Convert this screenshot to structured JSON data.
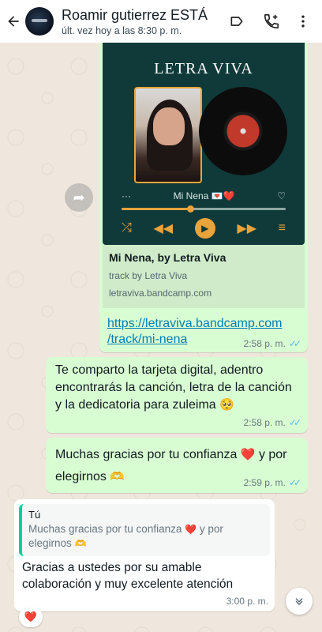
{
  "header": {
    "contact_name": "Roamir gutierrez ESTÁ",
    "status": "últ. vez hoy a las 8:30 p. m.",
    "icons": [
      "back-arrow-icon",
      "label-icon",
      "add-call-icon",
      "more-vert-icon"
    ]
  },
  "card": {
    "logo": "LETRA VIVA",
    "song": "Mi Nena",
    "song_emojis": "💌❤️",
    "progress": 0.42
  },
  "link_preview": {
    "title": "Mi Nena, by Letra Viva",
    "description": "track by Letra Viva",
    "domain": "letraviva.bandcamp.com"
  },
  "messages": [
    {
      "id": "m1",
      "url_line1": "https://letraviva.bandcamp.com",
      "url_line2": "/track/mi-nena",
      "time": "2:58 p. m."
    },
    {
      "id": "m2",
      "text": "Te comparto la tarjeta digital, adentro encontrarás la canción, letra de la canción y la dedicatoria para zuleima",
      "emoji": "🥺",
      "time": "2:58 p. m."
    },
    {
      "id": "m3",
      "text": "Muchas gracias por tu confianza",
      "emoji1": "❤️",
      "text2": "y por elegirnos",
      "emoji2": "🫶",
      "time": "2:59 p. m."
    },
    {
      "id": "m4",
      "quote_author": "Tú",
      "quote_text": "Muchas gracias por tu confianza",
      "quote_emoji1": "❤️",
      "quote_text2": "y por elegirnos",
      "quote_emoji2": "🫶",
      "text": "Gracias a ustedes por su amable colaboración y muy excelente atención",
      "time": "3:00 p. m.",
      "reaction": "❤️"
    }
  ],
  "colors": {
    "outgoing": "#d9fdd3",
    "incoming": "#ffffff",
    "card_bg": "#103a3a",
    "accent": "#e8a33a",
    "ticks": "#53bdeb"
  }
}
